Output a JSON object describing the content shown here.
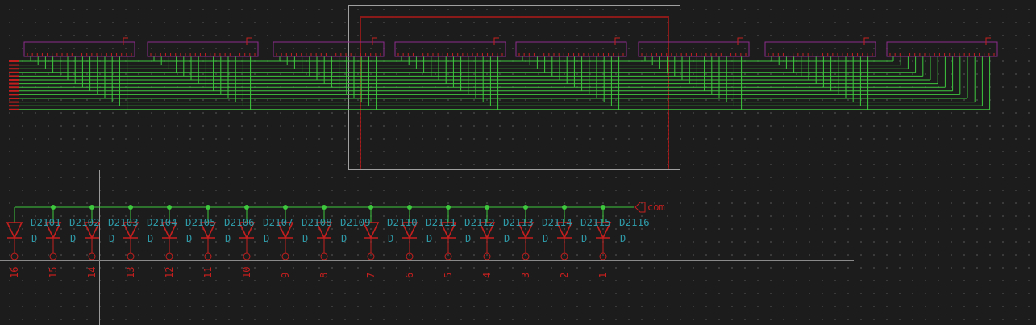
{
  "colors": {
    "background": "#1c1c1c",
    "grid_dot": "#454545",
    "wire": "#3ec83e",
    "junction": "#3ec83e",
    "component": "#c41f1f",
    "component_box": "#8c2c8c",
    "text_teal": "#2e9aa8",
    "text_red": "#c41f1f",
    "sheet_frame": "#a0a0a0",
    "sheet_inner": "#8a1a1a",
    "crosshair": "#9a9a9a",
    "baseline": "#8a8a8a"
  },
  "net_label": {
    "text": "com",
    "icon": "global-label-arrow-icon"
  },
  "diodes": [
    {
      "ref": "D2101",
      "value": "D",
      "pin": "16"
    },
    {
      "ref": "D2102",
      "value": "D",
      "pin": "15"
    },
    {
      "ref": "D2103",
      "value": "D",
      "pin": "14"
    },
    {
      "ref": "D2104",
      "value": "D",
      "pin": "13"
    },
    {
      "ref": "D2105",
      "value": "D",
      "pin": "12"
    },
    {
      "ref": "D2106",
      "value": "D",
      "pin": "11"
    },
    {
      "ref": "D2107",
      "value": "D",
      "pin": "10"
    },
    {
      "ref": "D2108",
      "value": "D",
      "pin": "9"
    },
    {
      "ref": "D2109",
      "value": "D",
      "pin": "8"
    },
    {
      "ref": "D2110",
      "value": "D",
      "pin": "7"
    },
    {
      "ref": "D2111",
      "value": "D",
      "pin": "6"
    },
    {
      "ref": "D2112",
      "value": "D",
      "pin": "5"
    },
    {
      "ref": "D2113",
      "value": "D",
      "pin": "4"
    },
    {
      "ref": "D2114",
      "value": "D",
      "pin": "3"
    },
    {
      "ref": "D2115",
      "value": "D",
      "pin": "2"
    },
    {
      "ref": "D2116",
      "value": "D",
      "pin": "1"
    }
  ],
  "connector_blocks": 8,
  "bus_lines": 14
}
